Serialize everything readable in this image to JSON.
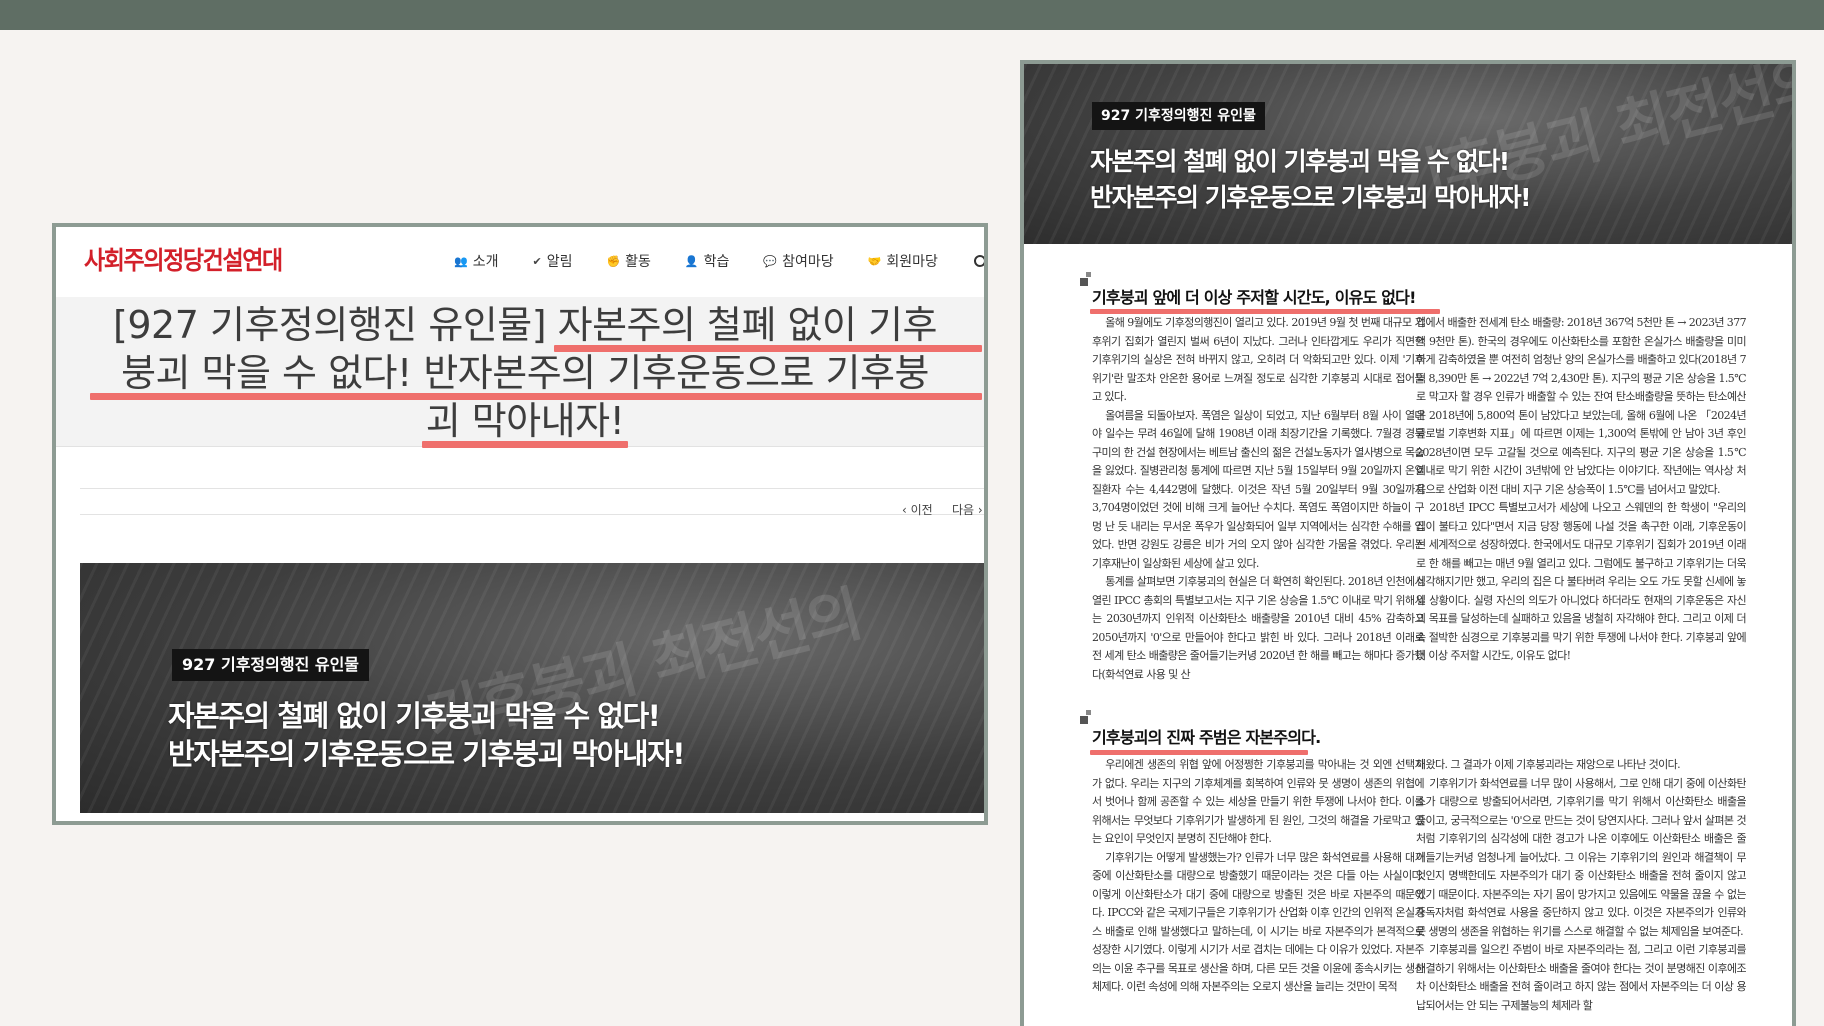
{
  "site": {
    "logo": "사회주의정당건설연대",
    "nav": [
      {
        "icon": "users-icon",
        "glyph": "👥",
        "label": "소개"
      },
      {
        "icon": "check-icon",
        "glyph": "✔",
        "label": "알림"
      },
      {
        "icon": "fist-icon",
        "glyph": "✊",
        "label": "활동"
      },
      {
        "icon": "study-icon",
        "glyph": "👤",
        "label": "학습"
      },
      {
        "icon": "chat-icon",
        "glyph": "💬",
        "label": "참여마당"
      },
      {
        "icon": "handshake-icon",
        "glyph": "🤝",
        "label": "회원마당"
      }
    ],
    "title_line1": "[927 기후정의행진 유인물] 자본주의 철폐 없이 기후",
    "title_line2": "붕괴 막을 수 없다! 반자본주의 기후운동으로 기후붕",
    "title_line3": "괴 막아내자!",
    "prev_label": "이전",
    "next_label": "다음"
  },
  "hero": {
    "tag": "927 기후정의행진 유인물",
    "headline_line1": "자본주의 철폐 없이 기후붕괴 막을 수 없다!",
    "headline_line2": "반자본주의 기후운동으로 기후붕괴 막아내자!",
    "banner_text": "기후붕괴 최전선의"
  },
  "magazine": {
    "section1_title": "기후붕괴 앞에 더 이상 주저할 시간도, 이유도 없다!",
    "section1_col1": [
      "올해 9월에도 기후정의행진이 열리고 있다. 2019년 9월 첫 번째 대규모 기후위기 집회가 열린지 벌써 6년이 지났다. 그러나 인타깝게도 우리가 직면한 기후위기의 실상은 전혀 바뀌지 않고, 오히려 더 악화되고만 있다. 이제 '기후위기'란 말조차 안온한 용어로 느껴질 정도로 심각한 기후붕괴 시대로 접어들고 있다.",
      "올여름을 되돌아보자. 폭염은 일상이 되었고, 지난 6월부터 8월 사이 열대야 일수는 무려 46일에 달해 1908년 이래 최장기간을 기록했다. 7월경 경북 구미의 한 건설 현장에서는 베트남 출신의 젊은 건설노동자가 열사병으로 목숨을 잃었다. 질병관리청 통계에 따르면 지난 5월 15일부터 9월 20일까지 온열질환자 수는 4,442명에 달했다. 이것은 작년 5월 20일부터 9월 30일까지 3,704명이었던 것에 비해 크게 늘어난 수치다. 폭염도 폭염이지만 하늘이 구멍 난 듯 내리는 무서운 폭우가 일상화되어 일부 지역에서는 심각한 수해를 입었다. 반면 강원도 강릉은 비가 거의 오지 않아 심각한 가뭄을 겪었다. 우리는 기후재난이 일상화된 세상에 살고 있다.",
      "통계를 살펴보면 기후붕괴의 현실은 더 확연히 확인된다. 2018년 인천에서 열린 IPCC 총회의 특별보고서는 지구 기온 상승을 1.5℃ 이내로 막기 위해서는 2030년까지 인위적 이산화탄소 배출량을 2010년 대비 45% 감축하고 2050년까지 '0'으로 만들어야 한다고 밝힌 바 있다. 그러나 2018년 이래로 전 세계 탄소 배출량은 줄어들기는커녕 2020년 한 해를 빼고는 해마다 증가했다(화석연료 사용 및 산"
    ],
    "section1_col2": [
      "업에서 배출한 전세계 탄소 배출량: 2018년 367억 5천만 톤 → 2023년 377억 9천만 톤). 한국의 경우에도 이산화탄소를 포함한 온실가스 배출량을 미미하게 감축하였을 뿐 여전히 엄청난 양의 온실가스를 배출하고 있다(2018년 7억 8,390만 톤 → 2022년 7억 2,430만 톤). 지구의 평균 기온 상승을 1.5℃로 막고자 할 경우 인류가 배출할 수 있는 잔여 탄소배출량을 뜻하는 탄소예산은 2018년에 5,800억 톤이 남았다고 보았는데, 올해 6월에 나온 「2024년 글로벌 기후변화 지표」에 따르면 이제는 1,300억 톤밖에 안 남아 3년 후인 2028년이면 모두 고갈될 것으로 예측된다. 지구의 평균 기온 상승을 1.5℃ 이내로 막기 위한 시간이 3년밖에 안 남았다는 이야기다. 작년에는 역사상 처음으로 산업화 이전 대비 지구 기온 상승폭이 1.5℃를 넘어서고 말았다.",
      "2018년 IPCC 특별보고서가 세상에 나오고 스웨덴의 한 학생이 \"우리의 집이 불타고 있다\"면서 지금 당장 행동에 나설 것을 촉구한 이래, 기후운동이 전 세계적으로 성장하였다. 한국에서도 대규모 기후위기 집회가 2019년 이래로 한 해를 빼고는 매년 9월 열리고 있다. 그럼에도 불구하고 기후위기는 더욱 심각해지기만 했고, 우리의 집은 다 불타버려 우리는 오도 가도 못할 신세에 놓일 상황이다. 실령 자신의 의도가 아니었다 하더라도 현재의 기후운동은 자신의 목표를 달성하는데 실패하고 있음을 냉철히 자각해야 한다. 그리고 이제 더 속 절박한 심경으로 기후붕괴를 막기 위한 투쟁에 나서야 한다. 기후붕괴 앞에 더 이상 주저할 시간도, 이유도 없다!"
    ],
    "section2_title": "기후붕괴의 진짜 주범은 자본주의다.",
    "section2_col1": [
      "우리에겐 생존의 위협 앞에 어정쩡한 기후붕괴를 막아내는 것 외엔 선택지가 없다. 우리는 지구의 기후체계를 회복하여 인류와 뭇 생명이 생존의 위협에서 벗어나 함께 공존할 수 있는 세상을 만들기 위한 투쟁에 나서야 한다. 이를 위해서는 무엇보다 기후위기가 발생하게 된 원인, 그것의 해결을 가로막고 있는 요인이 무엇인지 분명히 진단해야 한다.",
      "기후위기는 어떻게 발생했는가? 인류가 너무 많은 화석연료를 사용해 대기 중에 이산화탄소를 대량으로 방출했기 때문이라는 것은 다들 아는 사실이다. 이렇게 이산화탄소가 대기 중에 대량으로 방출된 것은 바로 자본주의 때문이다. IPCC와 같은 국제기구들은 기후위기가 산업화 이후 인간의 인위적 온실가스 배출로 인해 발생했다고 말하는데, 이 시기는 바로 자본주의가 본격적으로 성장한 시기였다. 이렇게 시기가 서로 겹치는 데에는 다 이유가 있었다. 자본주의는 이윤 추구를 목표로 생산을 하며, 다른 모든 것을 이윤에 종속시키는 생산체제다. 이런 속성에 의해 자본주의는 오로지 생산을 늘리는 것만이 목적"
    ],
    "section2_col2": [
      "해왔다. 그 결과가 이제 기후붕괴라는 재앙으로 나타난 것이다.",
      "기후위기가 화석연료를 너무 많이 사용해서, 그로 인해 대기 중에 이산화탄소가 대량으로 방출되어서라면, 기후위기를 막기 위해서 이산화탄소 배출을 줄이고, 궁극적으로는 '0'으로 만드는 것이 당연지사다. 그러나 앞서 살펴본 것처럼 기후위기의 심각성에 대한 경고가 나온 이후에도 이산화탄소 배출은 줄어들기는커녕 엄청나게 늘어났다. 그 이유는 기후위기의 원인과 해결책이 무엇인지 명백한데도 자본주의가 대기 중 이산화탄소 배출을 전혀 줄이지 않고 있기 때문이다. 자본주의는 자기 몸이 망가지고 있음에도 약물을 끊을 수 없는 중독자처럼 화석연료 사용을 중단하지 않고 있다. 이것은 자본주의가 인류와 뭇 생명의 생존을 위협하는 위기를 스스로 해결할 수 없는 체제임을 보여준다.",
      "기후붕괴를 일으킨 주범이 바로 자본주의라는 점, 그리고 이런 기후붕괴를 해결하기 위해서는 이산화탄소 배출을 줄여야 한다는 것이 분명해진 이후에조차 이산화탄소 배출을 전혀 줄이려고 하지 않는 점에서 자본주의는 더 이상 용납되어서는 안 되는 구제불능의 체제라 할"
    ]
  },
  "colors": {
    "highlight": "#ef6f6c",
    "logo_red": "#d3202a",
    "frame": "#8d9b93",
    "top_band": "#5f6e64"
  }
}
